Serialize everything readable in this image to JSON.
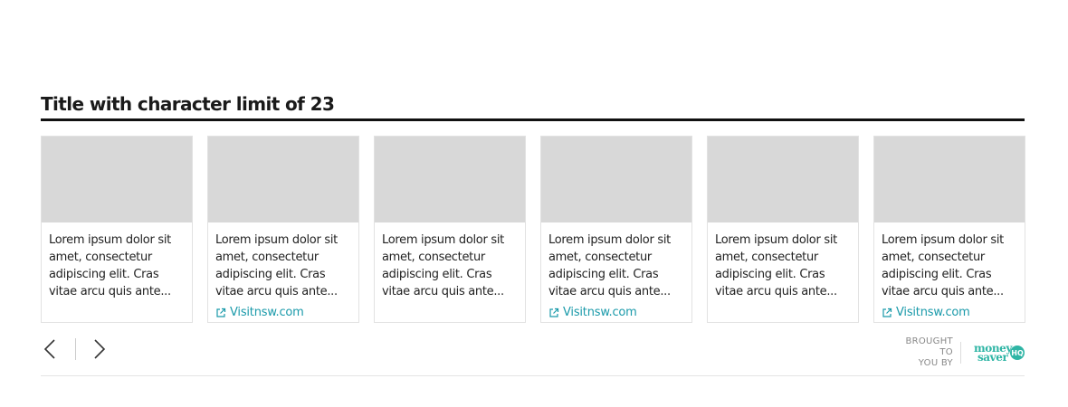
{
  "section": {
    "title": "Title with character limit of 23"
  },
  "cards": [
    {
      "text": "Lorem ipsum dolor sit amet, consectetur adipiscing elit. Cras vitae arcu quis ante...",
      "link": ""
    },
    {
      "text": "Lorem ipsum dolor sit amet, consectetur adipiscing elit. Cras vitae arcu quis ante...",
      "link": "Visitnsw.com"
    },
    {
      "text": "Lorem ipsum dolor sit amet, consectetur adipiscing elit. Cras vitae arcu quis ante...",
      "link": ""
    },
    {
      "text": "Lorem ipsum dolor sit amet, consectetur adipiscing elit. Cras vitae arcu quis ante...",
      "link": "Visitnsw.com"
    },
    {
      "text": "Lorem ipsum dolor sit amet, consectetur adipiscing elit. Cras vitae arcu quis ante...",
      "link": ""
    },
    {
      "text": "Lorem ipsum dolor sit amet, consectetur adipiscing elit. Cras vitae arcu quis ante...",
      "link": "Visitnsw.com"
    }
  ],
  "nav": {
    "prev_icon": "chevron-left-icon",
    "next_icon": "chevron-right-icon"
  },
  "sponsor": {
    "label_line1": "BROUGHT TO",
    "label_line2": "YOU BY",
    "logo_word1": "money",
    "logo_word2": "saver",
    "logo_badge": "HQ"
  },
  "colors": {
    "link": "#1a9aaa",
    "brand": "#2fb5a5",
    "image_placeholder": "#d8d8d8"
  }
}
